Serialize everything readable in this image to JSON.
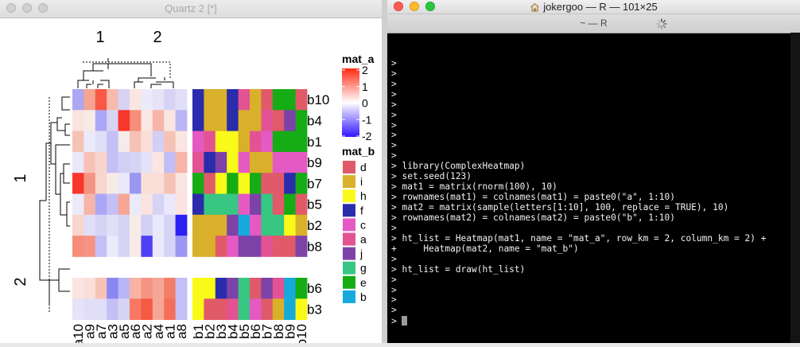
{
  "quartz_window": {
    "title": "Quartz 2 [*]",
    "heatmap": {
      "column_split_labels": [
        "1",
        "2"
      ],
      "row_split_labels": [
        "1",
        "2"
      ],
      "row_names": [
        "b10",
        "b4",
        "b1",
        "b9",
        "b7",
        "b5",
        "b2",
        "b8",
        "b6",
        "b3"
      ],
      "mat_a_column_groups": [
        [
          "a10",
          "a9",
          "a7",
          "a3",
          "a5"
        ],
        [
          "a6",
          "a2",
          "a4",
          "a1",
          "a8"
        ]
      ],
      "mat_b_columns": [
        "b1",
        "b2",
        "b3",
        "b4",
        "b5",
        "b6",
        "b7",
        "b8",
        "b9",
        "b10"
      ],
      "legend_mat_a": {
        "title": "mat_a",
        "ticks": [
          "2",
          "1",
          "0",
          "-1",
          "-2"
        ]
      },
      "legend_mat_b": {
        "title": "mat_b",
        "items": [
          {
            "label": "d",
            "color": "#e05a6a"
          },
          {
            "label": "i",
            "color": "#d9b02a"
          },
          {
            "label": "h",
            "color": "#fafa19"
          },
          {
            "label": "f",
            "color": "#2a2cac"
          },
          {
            "label": "c",
            "color": "#e45ac2"
          },
          {
            "label": "a",
            "color": "#e35394"
          },
          {
            "label": "j",
            "color": "#7d42a8"
          },
          {
            "label": "g",
            "color": "#37c782"
          },
          {
            "label": "e",
            "color": "#15ac15"
          },
          {
            "label": "b",
            "color": "#16aadb"
          }
        ]
      },
      "mat_a_color_rows": [
        [
          "#aca7f4",
          "#f4a490",
          "#f85845",
          "#f7bbae",
          "#d6d3f5",
          "#fbe5e1",
          "#ebeafa",
          "#e6e3f8",
          "#d6d3f5",
          "#e1dff7"
        ],
        [
          "#fbe3df",
          "#f6ebe7",
          "#aca7f4",
          "#d6d3f5",
          "#f8362a",
          "#f58e7a",
          "#fbe7e3",
          "#f6b5a8",
          "#fbe5e1",
          "#bab6f5"
        ],
        [
          "#f7c2b6",
          "#ebeafa",
          "#e1dff7",
          "#c4c0f6",
          "#f5ebea",
          "#f7c2b6",
          "#f9dfd8",
          "#d1cff6",
          "#f7c2b6",
          "#fbe5e1"
        ],
        [
          "#eae8fa",
          "#f7c2b6",
          "#f8d5cd",
          "#c4c0f6",
          "#d1cff6",
          "#d6d3f5",
          "#e4e2f8",
          "#fbe5e1",
          "#c1bdf6",
          "#f6b5a8"
        ],
        [
          "#f8362a",
          "#f59483",
          "#f8d5cd",
          "#f6ebe7",
          "#eae8fa",
          "#9a96f2",
          "#f9dfd8",
          "#f9dfd8",
          "#f7c2b6",
          "#fbe5e1"
        ],
        [
          "#ebeafa",
          "#f6b5a8",
          "#aca7f4",
          "#c4c0f6",
          "#f6a697",
          "#ebeafa",
          "#fbe3df",
          "#d6d3f5",
          "#eae8fa",
          "#fbe3df"
        ],
        [
          "#f8d5cd",
          "#e1dff7",
          "#d6d3f5",
          "#e1dff7",
          "#d6d3f5",
          "#f6ebe7",
          "#d1cff6",
          "#eae8fa",
          "#d6d3f5",
          "#2c21f3"
        ],
        [
          "#f58e7a",
          "#f59483",
          "#c4c0f6",
          "#ebeafa",
          "#d6d3f5",
          "#f6ebe7",
          "#4f41f3",
          "#eae8fa",
          "#d6d3f5",
          "#9a96f2"
        ],
        [
          "#fbe5e1",
          "#f9dfd8",
          "#f7c2b6",
          "#8a86f2",
          "#bab6f5",
          "#f7b2a3",
          "#f59483",
          "#f6a697",
          "#f27e69",
          "#c4c0f6"
        ],
        [
          "#e6e3f8",
          "#e1dff7",
          "#e1dff7",
          "#c4c0f6",
          "#d6d3f5",
          "#f87863",
          "#f45b44",
          "#f6a697",
          "#f46f5a",
          "#c4c0f6"
        ]
      ],
      "mat_b_value_rows": [
        [
          "f",
          "i",
          "i",
          "f",
          "a",
          "i",
          "d",
          "e",
          "e",
          "d"
        ],
        [
          "f",
          "i",
          "i",
          "f",
          "i",
          "i",
          "a",
          "d",
          "j",
          "e"
        ],
        [
          "c",
          "a",
          "h",
          "h",
          "i",
          "a",
          "c",
          "e",
          "e",
          "e"
        ],
        [
          "a",
          "f",
          "j",
          "h",
          "c",
          "i",
          "i",
          "c",
          "c",
          "c"
        ],
        [
          "e",
          "d",
          "h",
          "e",
          "h",
          "e",
          "d",
          "d",
          "f",
          "e"
        ],
        [
          "f",
          "g",
          "g",
          "g",
          "c",
          "j",
          "g",
          "d",
          "e",
          "d"
        ],
        [
          "i",
          "i",
          "i",
          "j",
          "b",
          "c",
          "g",
          "g",
          "h",
          "i"
        ],
        [
          "i",
          "i",
          "d",
          "c",
          "j",
          "j",
          "a",
          "d",
          "d",
          "j"
        ],
        [
          "h",
          "h",
          "f",
          "j",
          "g",
          "d",
          "j",
          "a",
          "b",
          "e"
        ],
        [
          "h",
          "d",
          "d",
          "a",
          "g",
          "c",
          "d",
          "i",
          "b",
          "h"
        ]
      ]
    }
  },
  "terminal_window": {
    "title": "jokergoo — R — 101×25",
    "tab_label": "~ — R",
    "lines": [
      ">",
      ">",
      ">",
      ">",
      ">",
      ">",
      ">",
      ">",
      ">",
      ">",
      "> library(ComplexHeatmap)",
      "> set.seed(123)",
      "> mat1 = matrix(rnorm(100), 10)",
      "> rownames(mat1) = colnames(mat1) = paste0(\"a\", 1:10)",
      "> mat2 = matrix(sample(letters[1:10], 100, replace = TRUE), 10)",
      "> rownames(mat2) = colnames(mat2) = paste0(\"b\", 1:10)",
      ">",
      "> ht_list = Heatmap(mat1, name = \"mat_a\", row_km = 2, column_km = 2) +",
      "+     Heatmap(mat2, name = \"mat_b\")",
      ">",
      "> ht_list = draw(ht_list)",
      ">",
      ">",
      ">",
      ">"
    ],
    "prompt": "> "
  }
}
